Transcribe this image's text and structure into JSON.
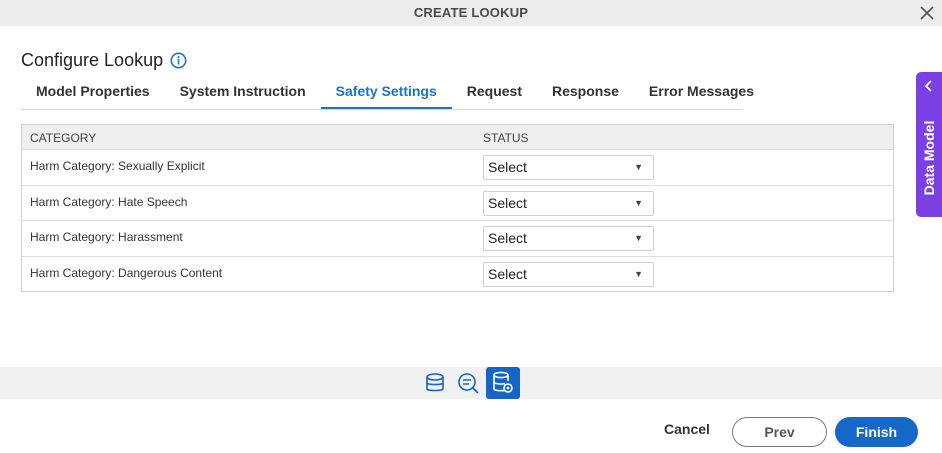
{
  "dialog": {
    "title": "CREATE LOOKUP"
  },
  "page": {
    "title": "Configure Lookup"
  },
  "tabs": [
    {
      "label": "Model Properties",
      "active": false
    },
    {
      "label": "System Instruction",
      "active": false
    },
    {
      "label": "Safety Settings",
      "active": true
    },
    {
      "label": "Request",
      "active": false
    },
    {
      "label": "Response",
      "active": false
    },
    {
      "label": "Error Messages",
      "active": false
    }
  ],
  "grid": {
    "headers": {
      "category": "CATEGORY",
      "status": "STATUS"
    },
    "rows": [
      {
        "category": "Harm Category: Sexually Explicit",
        "status": "Select"
      },
      {
        "category": "Harm Category: Hate Speech",
        "status": "Select"
      },
      {
        "category": "Harm Category: Harassment",
        "status": "Select"
      },
      {
        "category": "Harm Category: Dangerous Content",
        "status": "Select"
      }
    ]
  },
  "side_panel": {
    "label": "Data Model"
  },
  "toolbar_icons": [
    "database-icon",
    "search-comment-icon",
    "database-settings-icon"
  ],
  "footer": {
    "cancel_label": "Cancel",
    "prev_label": "Prev",
    "finish_label": "Finish"
  },
  "colors": {
    "accent": "#1a73c9",
    "side_panel": "#7b3fe4",
    "finish_button": "#1668c8"
  }
}
